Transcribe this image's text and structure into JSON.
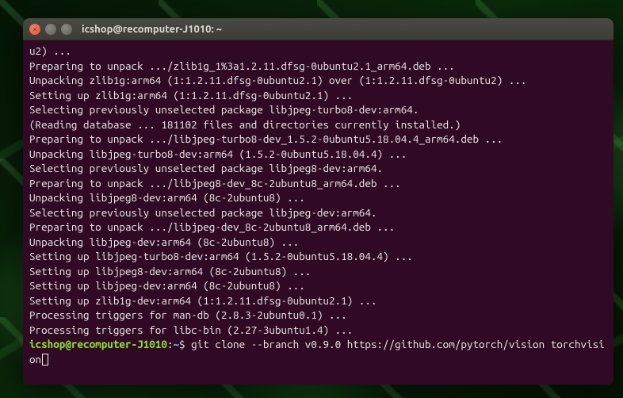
{
  "window": {
    "title": "icshop@recomputer-J1010: ~"
  },
  "prompt": {
    "user_host": "icshop@recomputer-J1010",
    "sep1": ":",
    "path": "~",
    "sep2": "$ "
  },
  "command": "git clone --branch v0.9.0 https://github.com/pytorch/vision torchvision",
  "output_lines": [
    "u2) ...",
    "Preparing to unpack .../zlib1g_1%3a1.2.11.dfsg-0ubuntu2.1_arm64.deb ...",
    "Unpacking zlib1g:arm64 (1:1.2.11.dfsg-0ubuntu2.1) over (1:1.2.11.dfsg-0ubuntu2) ...",
    "Setting up zlib1g:arm64 (1:1.2.11.dfsg-0ubuntu2.1) ...",
    "Selecting previously unselected package libjpeg-turbo8-dev:arm64.",
    "(Reading database ... 181102 files and directories currently installed.)",
    "Preparing to unpack .../libjpeg-turbo8-dev_1.5.2-0ubuntu5.18.04.4_arm64.deb ...",
    "Unpacking libjpeg-turbo8-dev:arm64 (1.5.2-0ubuntu5.18.04.4) ...",
    "Selecting previously unselected package libjpeg8-dev:arm64.",
    "Preparing to unpack .../libjpeg8-dev_8c-2ubuntu8_arm64.deb ...",
    "Unpacking libjpeg8-dev:arm64 (8c-2ubuntu8) ...",
    "Selecting previously unselected package libjpeg-dev:arm64.",
    "Preparing to unpack .../libjpeg-dev_8c-2ubuntu8_arm64.deb ...",
    "Unpacking libjpeg-dev:arm64 (8c-2ubuntu8) ...",
    "Setting up libjpeg-turbo8-dev:arm64 (1.5.2-0ubuntu5.18.04.4) ...",
    "Setting up libjpeg8-dev:arm64 (8c-2ubuntu8) ...",
    "Setting up libjpeg-dev:arm64 (8c-2ubuntu8) ...",
    "Setting up zlib1g-dev:arm64 (1:1.2.11.dfsg-0ubuntu2.1) ...",
    "Processing triggers for man-db (2.8.3-2ubuntu0.1) ...",
    "Processing triggers for libc-bin (2.27-3ubuntu1.4) ..."
  ]
}
